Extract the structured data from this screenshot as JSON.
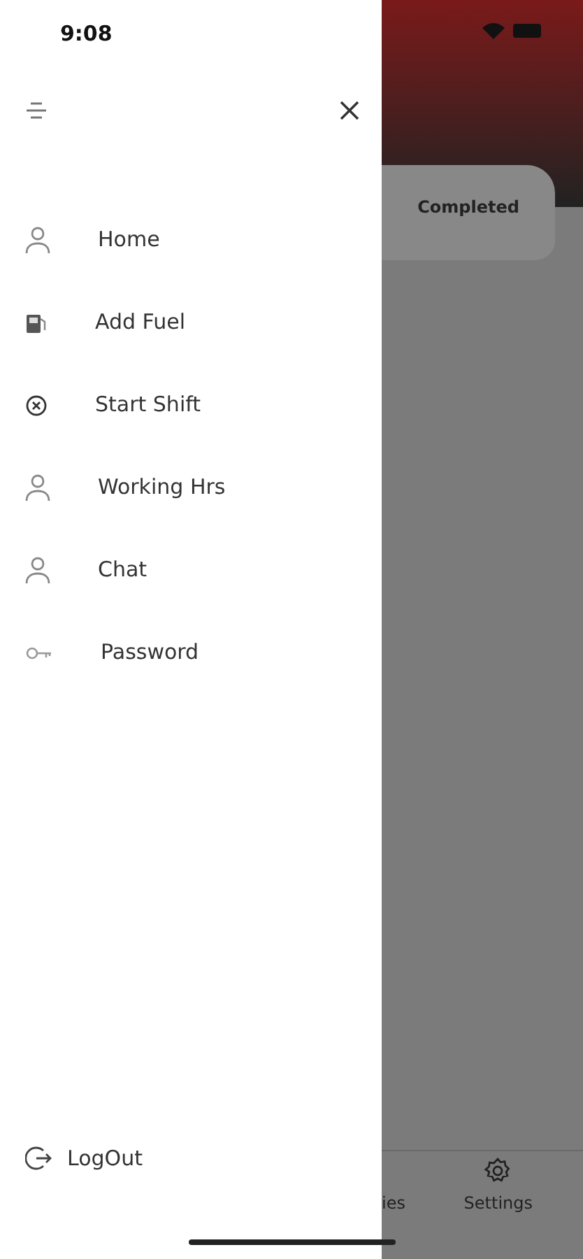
{
  "status_bar": {
    "time": "9:08"
  },
  "drawer": {
    "items": [
      {
        "label": "Home",
        "kind": "person"
      },
      {
        "label": "Add Fuel",
        "kind": "fuel"
      },
      {
        "label": "Start Shift",
        "kind": "cancel"
      },
      {
        "label": "Working Hrs",
        "kind": "person"
      },
      {
        "label": "Chat",
        "kind": "person"
      },
      {
        "label": "Password",
        "kind": "key"
      }
    ],
    "logout": {
      "label": "LogOut"
    }
  },
  "background": {
    "tab": "Completed",
    "bottom_nav": [
      {
        "label": "ies",
        "kind": "plain"
      },
      {
        "label": "Settings",
        "kind": "settings"
      }
    ]
  }
}
